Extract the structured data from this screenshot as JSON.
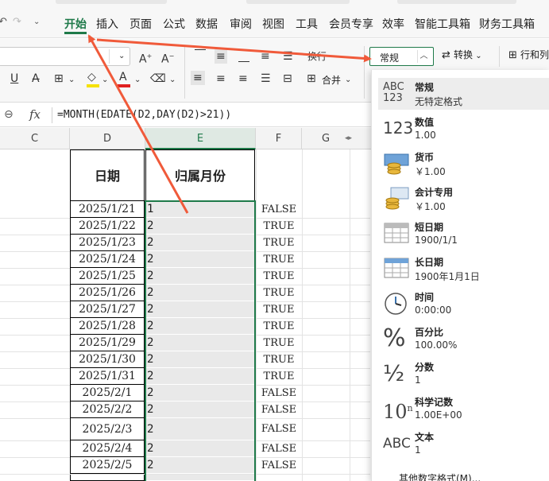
{
  "menu": {
    "tabs": [
      "开始",
      "插入",
      "页面",
      "公式",
      "数据",
      "审阅",
      "视图",
      "工具",
      "会员专享",
      "效率",
      "智能工具箱",
      "财务工具箱"
    ]
  },
  "ribbon": {
    "number_format_value": "常规",
    "convert_label": "转换",
    "rowcol_label": "行和列",
    "merge_label": "合并",
    "wrap_label": "换行"
  },
  "formula_bar": {
    "formula": "=MONTH(EDATE(D2,DAY(D2)>21))"
  },
  "columns": [
    "C",
    "D",
    "E",
    "F",
    "G"
  ],
  "table": {
    "header_date": "日期",
    "header_month": "归属月份",
    "rows": [
      {
        "date": "2025/1/21",
        "month": "1",
        "flag": "FALSE"
      },
      {
        "date": "2025/1/22",
        "month": "2",
        "flag": "TRUE"
      },
      {
        "date": "2025/1/23",
        "month": "2",
        "flag": "TRUE"
      },
      {
        "date": "2025/1/24",
        "month": "2",
        "flag": "TRUE"
      },
      {
        "date": "2025/1/25",
        "month": "2",
        "flag": "TRUE"
      },
      {
        "date": "2025/1/26",
        "month": "2",
        "flag": "TRUE"
      },
      {
        "date": "2025/1/27",
        "month": "2",
        "flag": "TRUE"
      },
      {
        "date": "2025/1/28",
        "month": "2",
        "flag": "TRUE"
      },
      {
        "date": "2025/1/29",
        "month": "2",
        "flag": "TRUE"
      },
      {
        "date": "2025/1/30",
        "month": "2",
        "flag": "TRUE"
      },
      {
        "date": "2025/1/31",
        "month": "2",
        "flag": "TRUE"
      },
      {
        "date": "2025/2/1",
        "month": "2",
        "flag": "FALSE"
      },
      {
        "date": "2025/2/2",
        "month": "2",
        "flag": "FALSE"
      },
      {
        "date": "2025/2/3",
        "month": "2",
        "flag": "FALSE"
      },
      {
        "date": "2025/2/4",
        "month": "2",
        "flag": "FALSE"
      },
      {
        "date": "2025/2/5",
        "month": "2",
        "flag": "FALSE"
      }
    ]
  },
  "number_formats": [
    {
      "name": "常规",
      "sample": "无特定格式",
      "icon": "general-format-icon",
      "selected": true
    },
    {
      "name": "数值",
      "sample": "1.00",
      "icon": "number-format-icon"
    },
    {
      "name": "货币",
      "sample": "￥1.00",
      "icon": "currency-format-icon"
    },
    {
      "name": "会计专用",
      "sample": "￥1.00",
      "icon": "accounting-format-icon"
    },
    {
      "name": "短日期",
      "sample": "1900/1/1",
      "icon": "short-date-icon"
    },
    {
      "name": "长日期",
      "sample": "1900年1月1日",
      "icon": "long-date-icon"
    },
    {
      "name": "时间",
      "sample": "0:00:00",
      "icon": "clock-icon"
    },
    {
      "name": "百分比",
      "sample": "100.00%",
      "icon": "percent-icon"
    },
    {
      "name": "分数",
      "sample": "1",
      "icon": "fraction-icon"
    },
    {
      "name": "科学记数",
      "sample": "1.00E+00",
      "icon": "scientific-icon"
    },
    {
      "name": "文本",
      "sample": "1",
      "icon": "text-format-icon"
    }
  ],
  "more_formats_label": "其他数字格式(M)...",
  "icon_text": {
    "general": [
      "ABC",
      "123"
    ],
    "number": "123",
    "percent": "%",
    "fraction": "½",
    "scientific": "10",
    "scientific_exp": "n",
    "text_format": "ABC",
    "fx": "fx"
  },
  "colors": {
    "accent": "#1f7a4a",
    "arrow": "#f05a3a",
    "font_color_bar": "#e02020",
    "highlight_bar": "#f5e100"
  }
}
